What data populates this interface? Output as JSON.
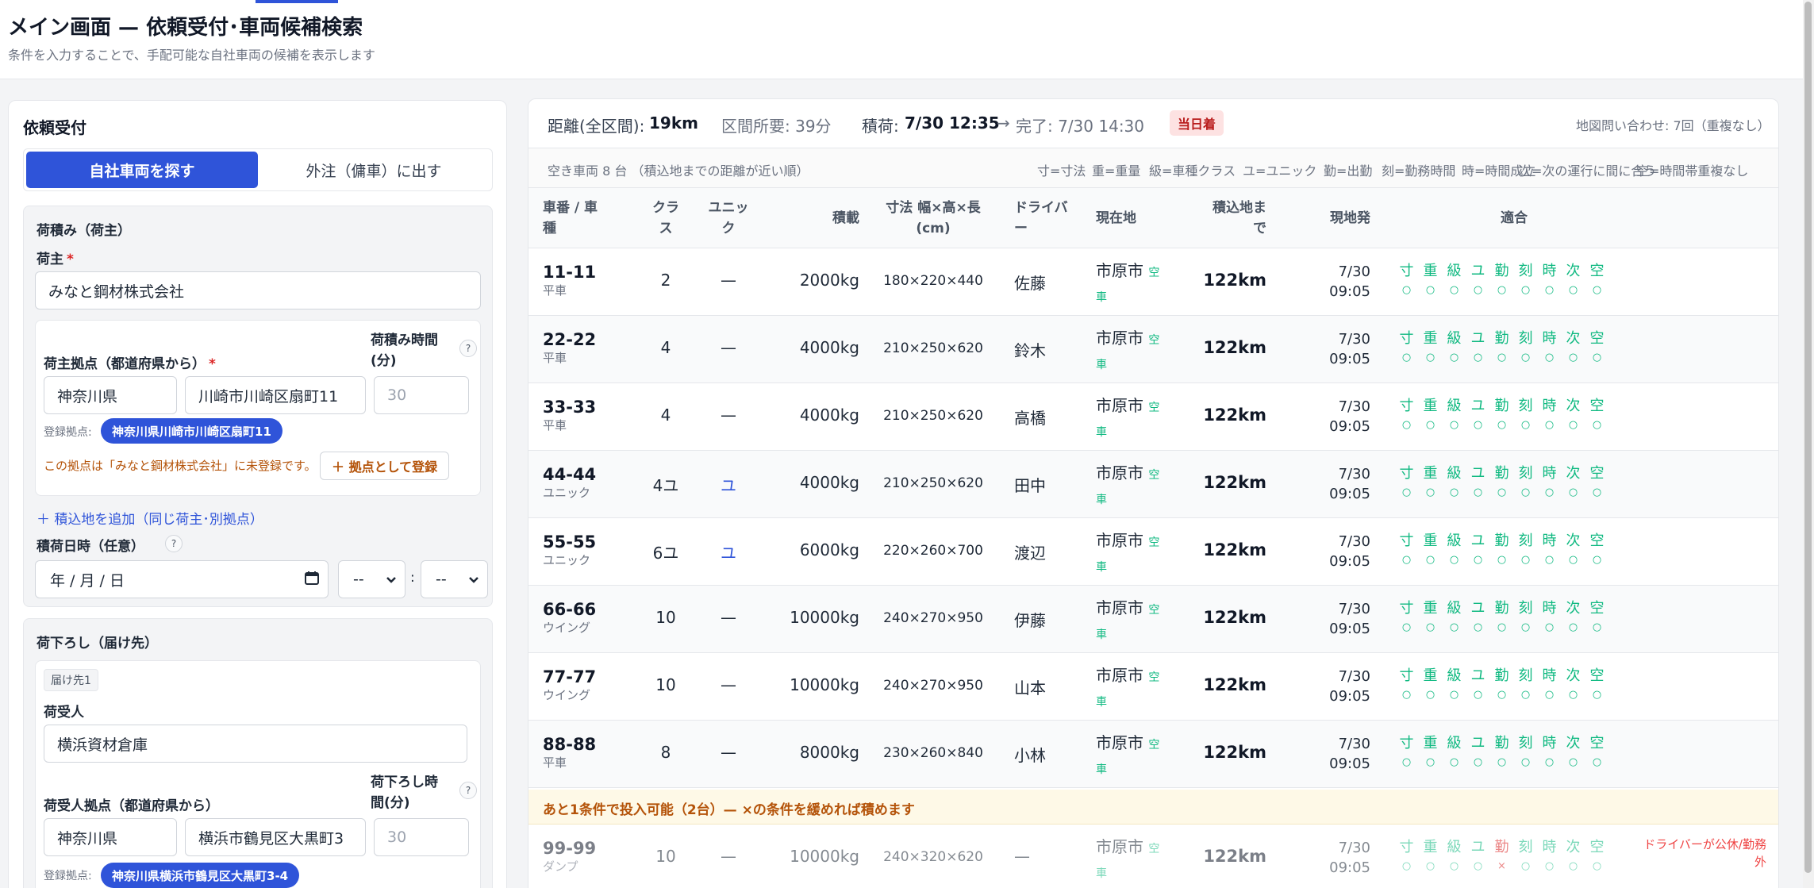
{
  "header": {
    "title": "メイン画面 — 依頼受付･車両候補検索",
    "subtitle": "条件を入力することで、手配可能な自社車両の候補を表示します"
  },
  "intake": {
    "title": "依頼受付",
    "mode_own": "自社車両を探す",
    "mode_outsource": "外注（傭車）に出す",
    "pickup": {
      "section_title": "荷積み（荷主）",
      "shipper_label": "荷主",
      "shipper_value": "みなと鋼材株式会社",
      "base_label": "荷主拠点（都道府県から）",
      "load_time_label_1": "荷積み時間",
      "load_time_label_2": "(分)",
      "prefecture": "神奈川県",
      "address": "川崎市川崎区扇町11",
      "minutes_placeholder": "30",
      "registered_label": "登録拠点:",
      "registered_pill": "神奈川県川崎市川崎区扇町11",
      "unregistered_warning": "この拠点は「みなと鋼材株式会社」に未登録です。",
      "register_button": "＋ 拠点として登録",
      "add_pickup_link": "＋ 積込地を追加（同じ荷主･別拠点）",
      "datetime_label": "積荷日時（任意）",
      "date_placeholder": "年 / 月 / 日",
      "hour_placeholder": "--",
      "minute_placeholder": "--",
      "colon": ":"
    },
    "delivery": {
      "section_title": "荷下ろし（届け先）",
      "dest_tag": "届け先1",
      "consignee_label": "荷受人",
      "consignee_value": "横浜資材倉庫",
      "base_label": "荷受人拠点（都道府県から）",
      "unload_time_label_1": "荷下ろし時",
      "unload_time_label_2": "間(分)",
      "prefecture": "神奈川県",
      "address": "横浜市鶴見区大黒町3",
      "minutes_placeholder": "30",
      "registered_label": "登録拠点:",
      "registered_pill": "神奈川県横浜市鶴見区大黒町3-4"
    }
  },
  "summary": {
    "distance_label": "距離(全区間):",
    "distance_value": "19km",
    "duration": "区間所要: 39分",
    "load_label": "積荷:",
    "load_value": "7/30 12:35",
    "arrow": "→",
    "complete": "完了: 7/30 14:30",
    "same_day_badge": "当日着",
    "map_queries": "地図問い合わせ: 7回（重複なし）"
  },
  "legend": {
    "count": "空き車両 8 台 （積込地までの距離が近い順）",
    "items": [
      "寸=寸法",
      "重=重量",
      "級=車種クラス",
      "ユ=ユニック",
      "勤=出勤",
      "刻=勤務時間",
      "時=時間成立",
      "次=次の運行に間に合う",
      "空=時間帯重複なし"
    ]
  },
  "table": {
    "headers": {
      "plate_1": "車番 / 車",
      "plate_2": "種",
      "class_1": "クラ",
      "class_2": "ス",
      "unic_1": "ユニッ",
      "unic_2": "ク",
      "capacity": "積載",
      "dims_1": "寸法 幅×高×長",
      "dims_2": "(cm)",
      "driver_1": "ドライバ",
      "driver_2": "ー",
      "location": "現在地",
      "to_pickup_1": "積込地ま",
      "to_pickup_2": "で",
      "depart": "現地発",
      "fit": "適合"
    },
    "fit_labels": [
      "寸",
      "重",
      "級",
      "ユ",
      "勤",
      "刻",
      "時",
      "次",
      "空"
    ],
    "rows": [
      {
        "plate": "11-11",
        "type": "平車",
        "class": "2",
        "unic": "—",
        "capacity": "2000kg",
        "dims": "180×220×440",
        "driver": "佐藤",
        "location": "市原市",
        "avail_1": "空",
        "avail_2": "車",
        "distance": "122km",
        "date": "7/30",
        "time": "09:05",
        "marks": [
          "○",
          "○",
          "○",
          "○",
          "○",
          "○",
          "○",
          "○",
          "○"
        ]
      },
      {
        "plate": "22-22",
        "type": "平車",
        "class": "4",
        "unic": "—",
        "capacity": "4000kg",
        "dims": "210×250×620",
        "driver": "鈴木",
        "location": "市原市",
        "avail_1": "空",
        "avail_2": "車",
        "distance": "122km",
        "date": "7/30",
        "time": "09:05",
        "marks": [
          "○",
          "○",
          "○",
          "○",
          "○",
          "○",
          "○",
          "○",
          "○"
        ]
      },
      {
        "plate": "33-33",
        "type": "平車",
        "class": "4",
        "unic": "—",
        "capacity": "4000kg",
        "dims": "210×250×620",
        "driver": "高橋",
        "location": "市原市",
        "avail_1": "空",
        "avail_2": "車",
        "distance": "122km",
        "date": "7/30",
        "time": "09:05",
        "marks": [
          "○",
          "○",
          "○",
          "○",
          "○",
          "○",
          "○",
          "○",
          "○"
        ]
      },
      {
        "plate": "44-44",
        "type": "ユニック",
        "class": "4ユ",
        "unic": "ユ",
        "capacity": "4000kg",
        "dims": "210×250×620",
        "driver": "田中",
        "location": "市原市",
        "avail_1": "空",
        "avail_2": "車",
        "distance": "122km",
        "date": "7/30",
        "time": "09:05",
        "marks": [
          "○",
          "○",
          "○",
          "○",
          "○",
          "○",
          "○",
          "○",
          "○"
        ]
      },
      {
        "plate": "55-55",
        "type": "ユニック",
        "class": "6ユ",
        "unic": "ユ",
        "capacity": "6000kg",
        "dims": "220×260×700",
        "driver": "渡辺",
        "location": "市原市",
        "avail_1": "空",
        "avail_2": "車",
        "distance": "122km",
        "date": "7/30",
        "time": "09:05",
        "marks": [
          "○",
          "○",
          "○",
          "○",
          "○",
          "○",
          "○",
          "○",
          "○"
        ]
      },
      {
        "plate": "66-66",
        "type": "ウイング",
        "class": "10",
        "unic": "—",
        "capacity": "10000kg",
        "dims": "240×270×950",
        "driver": "伊藤",
        "location": "市原市",
        "avail_1": "空",
        "avail_2": "車",
        "distance": "122km",
        "date": "7/30",
        "time": "09:05",
        "marks": [
          "○",
          "○",
          "○",
          "○",
          "○",
          "○",
          "○",
          "○",
          "○"
        ]
      },
      {
        "plate": "77-77",
        "type": "ウイング",
        "class": "10",
        "unic": "—",
        "capacity": "10000kg",
        "dims": "240×270×950",
        "driver": "山本",
        "location": "市原市",
        "avail_1": "空",
        "avail_2": "車",
        "distance": "122km",
        "date": "7/30",
        "time": "09:05",
        "marks": [
          "○",
          "○",
          "○",
          "○",
          "○",
          "○",
          "○",
          "○",
          "○"
        ]
      },
      {
        "plate": "88-88",
        "type": "平車",
        "class": "8",
        "unic": "—",
        "capacity": "8000kg",
        "dims": "230×260×840",
        "driver": "小林",
        "location": "市原市",
        "avail_1": "空",
        "avail_2": "車",
        "distance": "122km",
        "date": "7/30",
        "time": "09:05",
        "marks": [
          "○",
          "○",
          "○",
          "○",
          "○",
          "○",
          "○",
          "○",
          "○"
        ]
      }
    ],
    "near_miss_note": "あと1条件で投入可能（2台）— ×の条件を緩めれば積めます",
    "near_miss_rows": [
      {
        "plate": "99-99",
        "type": "ダンプ",
        "class": "10",
        "unic": "—",
        "capacity": "10000kg",
        "dims": "240×320×620",
        "driver": "—",
        "location": "市原市",
        "avail_1": "空",
        "avail_2": "車",
        "distance": "122km",
        "date": "7/30",
        "time": "09:05",
        "marks": [
          "○",
          "○",
          "○",
          "○",
          "×",
          "○",
          "○",
          "○",
          "○"
        ],
        "reason_1": "ドライバーが公休/勤務",
        "reason_2": "外"
      }
    ]
  },
  "colors": {
    "accent": "#2f54d9",
    "ok": "#10b981",
    "ng": "#dc2626",
    "warn": "#b45309"
  }
}
